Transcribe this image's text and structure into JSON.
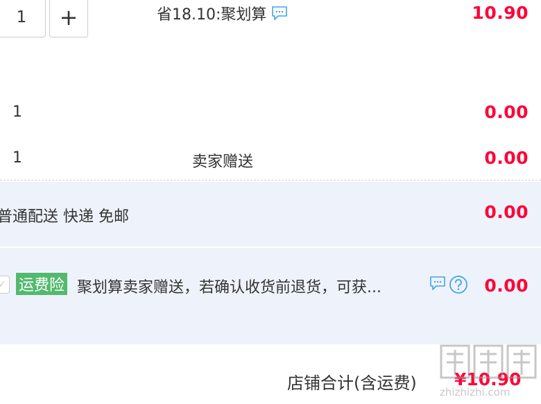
{
  "item_main": {
    "quantity": "1",
    "plus_label": "+",
    "promo_text": "省18.10:聚划算",
    "price": "10.90"
  },
  "gift_rows": [
    {
      "quantity": "1",
      "label": "",
      "price": "0.00"
    },
    {
      "quantity": "1",
      "label": "卖家赠送",
      "price": "0.00"
    }
  ],
  "shipping": {
    "label": "普通配送 快递 免邮",
    "price": "0.00"
  },
  "insurance": {
    "check_mark": "✓",
    "tag": "运费险",
    "description": "聚划算卖家赠送，若确认收货前退货，可获...",
    "price": "0.00"
  },
  "footer": {
    "total_label": "店铺合计(含运费)",
    "total_price": "¥10.90"
  },
  "watermark": {
    "brand": "值",
    "url": "zhizhizhi.com"
  },
  "colors": {
    "price_red": "#ff0036",
    "band_blue": "#eef3fb",
    "tag_green": "#52b96d",
    "icon_blue": "#3fa5e6"
  }
}
